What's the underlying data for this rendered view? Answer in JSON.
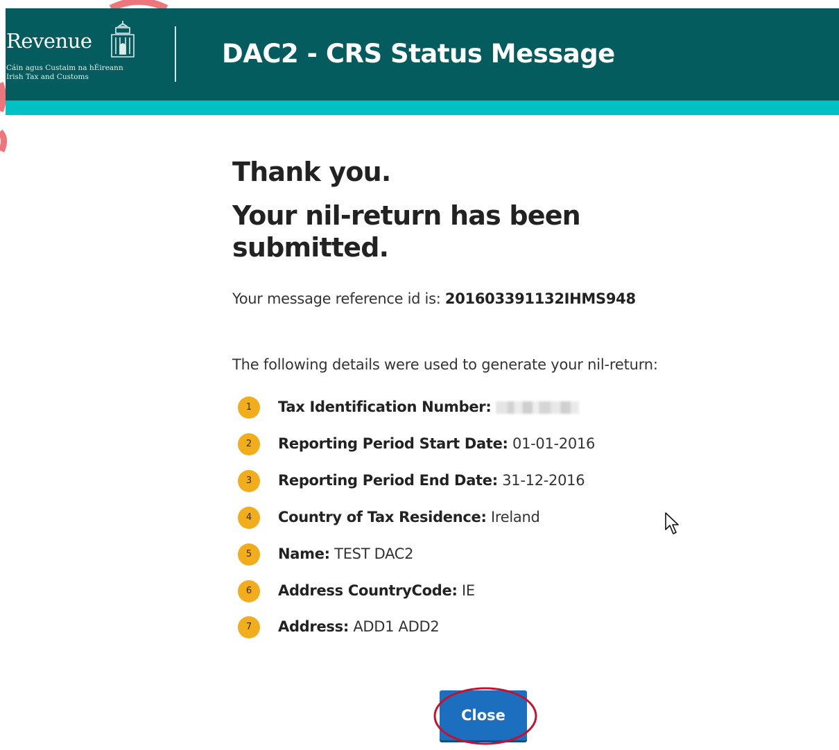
{
  "header": {
    "logo_word": "Revenue",
    "logo_sub_line1": "Cáin agus Custaim na hÉireann",
    "logo_sub_line2": "Irish Tax and Customs",
    "title": "DAC2 - CRS Status Message"
  },
  "main": {
    "thank_you": "Thank you.",
    "submitted": "Your nil-return has been submitted.",
    "reference_prefix": "Your message reference id is:",
    "reference_id": "201603391132IHMS948",
    "intro": "The following details were used to generate your nil-return:",
    "details": [
      {
        "number": "1",
        "label": "Tax Identification Number:",
        "value": ""
      },
      {
        "number": "2",
        "label": "Reporting Period Start Date:",
        "value": "01-01-2016"
      },
      {
        "number": "3",
        "label": "Reporting Period End Date:",
        "value": "31-12-2016"
      },
      {
        "number": "4",
        "label": "Country of Tax Residence:",
        "value": "Ireland"
      },
      {
        "number": "5",
        "label": "Name:",
        "value": "TEST DAC2"
      },
      {
        "number": "6",
        "label": "Address CountryCode:",
        "value": "IE"
      },
      {
        "number": "7",
        "label": "Address:",
        "value": "ADD1 ADD2"
      }
    ],
    "close_label": "Close"
  },
  "colors": {
    "header_bg": "#045c5e",
    "header_stripe": "#00c2c5",
    "number_badge": "#f2ad1d",
    "button": "#1c6fbf",
    "annotation_ring": "#c8102e"
  },
  "icons": {
    "logo": "harp-building-icon",
    "pointer": "mouse-cursor-icon"
  }
}
